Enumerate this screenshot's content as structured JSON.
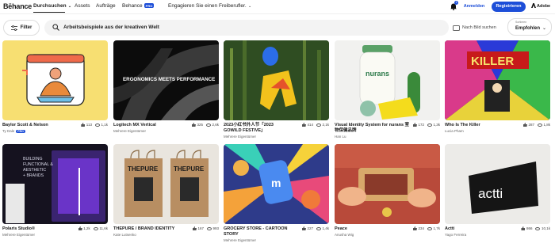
{
  "nav": {
    "logo": "Bēhance",
    "browse": "Durchsuchen",
    "assets": "Assets",
    "jobs": "Aufträge",
    "pro": "Behance",
    "pro_badge": "PRO",
    "hire": "Engagieren Sie einen Freiberufler.",
    "notification_count": "1",
    "login": "Anmelden",
    "register": "Registrieren",
    "adobe": "Adobe"
  },
  "search": {
    "filter": "Filter",
    "query": "Arbeitsbeispiele aus der kreativen Welt",
    "image_search": "Nach Bild suchen",
    "sort_label": "Sortieren",
    "sort_value": "Empfohlen"
  },
  "colors": {
    "accent": "#1d4ed8"
  },
  "projects": [
    {
      "title": "Baylor Scott & Nelson",
      "owner": "Ty Dale",
      "owner_badge": "PRO",
      "likes": "113",
      "views": "1,1k"
    },
    {
      "title": "Logitech MX Vertical",
      "owner": "Mehrere Eigentümer",
      "likes": "325",
      "views": "2,6k",
      "thumb_text": "ERGONOMICS MEETS PERFORMANCE"
    },
    {
      "title": "2023小红书外人节「2023 GOWILD FESTIVE」",
      "owner": "Mehrere Eigentümer",
      "likes": "414",
      "views": "2,1k"
    },
    {
      "title": "Visual Identity System for nurans 室物保健品牌",
      "owner": "Han Lu",
      "likes": "172",
      "views": "1,3k",
      "thumb_text": "nurans"
    },
    {
      "title": "Who Is The Killer",
      "owner": "Lucia Pham",
      "likes": "287",
      "views": "1,8k",
      "thumb_text": "KILLER"
    },
    {
      "title": "Polaris Studio®",
      "owner": "Mehrere Eigentümer",
      "likes": "1,2k",
      "views": "11,6k",
      "thumb_text": "BUILDING FUNCTIONAL & AESTHETIC + BRANDS"
    },
    {
      "title": "THEPURE / BRAND IDENTITY",
      "owner": "Kate Lutsenko",
      "likes": "167",
      "views": "993",
      "thumb_text": "THEPURE"
    },
    {
      "title": "GROCERY STORE - CARTOON STORY",
      "owner": "Mehrere Eigentümer",
      "likes": "227",
      "views": "1,4k"
    },
    {
      "title": "Peace",
      "owner": "Anusha Wig",
      "likes": "234",
      "views": "1,7k"
    },
    {
      "title": "Actti",
      "owner": "Yago Ferreira",
      "likes": "866",
      "views": "10,1k",
      "thumb_text": "actti"
    }
  ]
}
